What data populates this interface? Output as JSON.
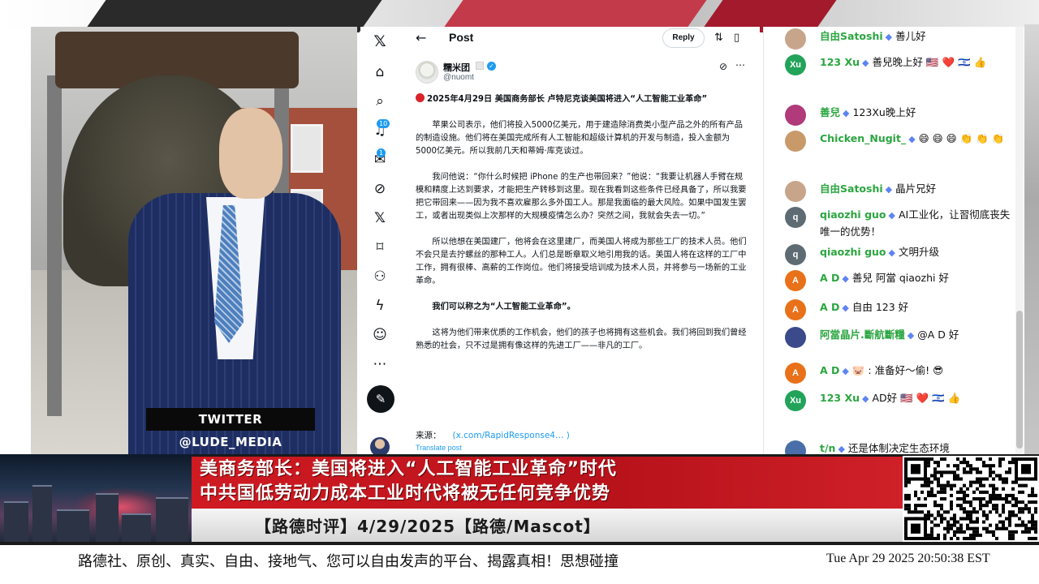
{
  "overlay": {
    "twitter_handle": "TWITTER  @LUDE_MEDIA"
  },
  "x_post": {
    "header_title": "Post",
    "reply_label": "Reply",
    "author_name": "糯米团",
    "author_handle": "@nuomt",
    "nav_badges": {
      "notifications": "10",
      "messages": "1"
    },
    "headline": "2025年4月29日 美国商务部长 卢特尼克谈美国将进入“人工智能工业革命”",
    "paragraphs": [
      "苹果公司表示，他们将投入5000亿美元，用于建造除消费类小型产品之外的所有产品的制造设施。他们将在美国完成所有人工智能和超级计算机的开发与制造，投入金额为5000亿美元。所以我前几天和蒂姆·库克谈过。",
      "我问他说：“你什么时候把 iPhone 的生产也带回来？”他说：“我要让机器人手臂在规模和精度上达到要求，才能把生产转移到这里。现在我看到这些条件已经具备了，所以我要把它带回来——因为我不喜欢雇那么多外国工人。那是我面临的最大风险。如果中国发生罢工，或者出现类似上次那样的大规模疫情怎么办？突然之间，我就会失去一切。”",
      "所以他想在美国建厂，他将会在这里建厂，而美国人将成为那些工厂的技术人员。他们不会只是去拧螺丝的那种工人。人们总是断章取义地引用我的话。美国人将在这样的工厂中工作，拥有很棒、高薪的工作岗位。他们将接受培训成为技术人员，并将参与一场新的工业革命。",
      "我们可以称之为“人工智能工业革命”。",
      "这将为他们带来优质的工作机会，他们的孩子也将拥有这些机会。我们将回到我们曾经熟悉的社会，只不过是拥有像这样的先进工厂——非凡的工厂。"
    ],
    "source_label": "来源：",
    "source_link": "(x.com/RapidResponse4… )",
    "translate_label": "Translate post"
  },
  "chat": {
    "messages": [
      {
        "user": "自由Satoshi",
        "text": "善儿好",
        "avatar": "",
        "avatar_color": "#c7a58a"
      },
      {
        "user": "123 Xu",
        "text": "善兒晚上好 🇺🇸 ❤️ 🇮🇱 👍",
        "avatar": "Xu",
        "avatar_color": "#22a35a"
      },
      {
        "user": "善兒",
        "text": "123Xu晚上好",
        "avatar": "",
        "avatar_color": "#b03a7a"
      },
      {
        "user": "Chicken_Nugit_",
        "text": "😄 😄 😄 👏 👏 👏",
        "avatar": "",
        "avatar_color": "#c89a6a"
      },
      {
        "user": "自由Satoshi",
        "text": "晶片兄好",
        "avatar": "",
        "avatar_color": "#c7a58a"
      },
      {
        "user": "qiaozhi guo",
        "text": "AI工业化，让習彻底丧失唯一的优势！",
        "avatar": "q",
        "avatar_color": "#5f6b73"
      },
      {
        "user": "qiaozhi guo",
        "text": "文明升级",
        "avatar": "q",
        "avatar_color": "#5f6b73"
      },
      {
        "user": "A D",
        "text": "善兒 阿當 qiaozhi 好",
        "avatar": "A",
        "avatar_color": "#e8711a"
      },
      {
        "user": "A D",
        "text": "自由 123 好",
        "avatar": "A",
        "avatar_color": "#e8711a"
      },
      {
        "user": "阿當晶片.斷航斷糧",
        "text": "@A D 好",
        "avatar": "",
        "avatar_color": "#3a4a8a"
      },
      {
        "user": "A D",
        "text": "🐷 : 准备好～偷! 😎",
        "avatar": "A",
        "avatar_color": "#e8711a"
      },
      {
        "user": "123 Xu",
        "text": "AD好 🇺🇸 ❤️ 🇮🇱 👍",
        "avatar": "Xu",
        "avatar_color": "#22a35a"
      },
      {
        "user": "t/n",
        "text": "还是体制决定生态环境",
        "avatar": "",
        "avatar_color": "#4a6fa8"
      }
    ]
  },
  "lower_third": {
    "headline_1": "美商务部长：美国将进入“人工智能工业革命”时代",
    "headline_2": "中共国低劳动力成本工业时代将被无任何竞争优势",
    "show_title": "【路德时评】4/29/2025【路德/Mascot】"
  },
  "ticker": {
    "text": "路德社、原创、真实、自由、接地气、您可以自由发声的平台、揭露真相！思想碰撞",
    "clock": "Tue Apr 29 2025 20:50:38 EST"
  },
  "colors": {
    "red_band": "#c0141d",
    "x_blue": "#1d9bf0",
    "chat_user_green": "#2ba640"
  }
}
